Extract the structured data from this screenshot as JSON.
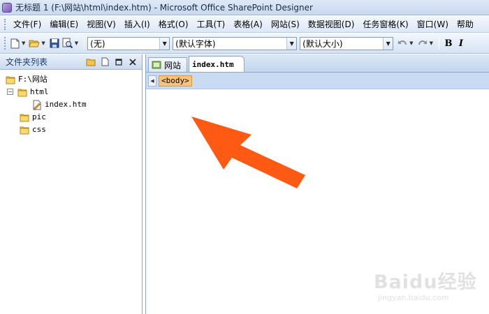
{
  "window": {
    "title": "无标题 1 (F:\\网站\\html\\index.htm) - Microsoft Office SharePoint Designer"
  },
  "menu": {
    "items": [
      "文件(F)",
      "编辑(E)",
      "视图(V)",
      "插入(I)",
      "格式(O)",
      "工具(T)",
      "表格(A)",
      "网站(S)",
      "数据视图(D)",
      "任务窗格(K)",
      "窗口(W)",
      "帮助"
    ]
  },
  "toolbar": {
    "style_select": "(无)",
    "font_select": "(默认字体)",
    "size_select": "(默认大小)",
    "bold_label": "B",
    "italic_label": "I"
  },
  "folder_panel": {
    "title": "文件夹列表",
    "tree": [
      {
        "label": "F:\\网站",
        "type": "root"
      },
      {
        "label": "html",
        "type": "folder",
        "expander": "⊟"
      },
      {
        "label": "index.htm",
        "type": "file"
      },
      {
        "label": "pic",
        "type": "folder"
      },
      {
        "label": "css",
        "type": "folder"
      }
    ]
  },
  "editor": {
    "tabs": [
      {
        "label": "网站",
        "active": false
      },
      {
        "label": "index.htm",
        "active": true
      }
    ],
    "tag_selector": "<body>"
  },
  "annotation": {
    "arrow_color": "#ff5a14"
  },
  "watermark": {
    "logo_text": "Baidu经验",
    "url": "jingyan.baidu.com"
  }
}
